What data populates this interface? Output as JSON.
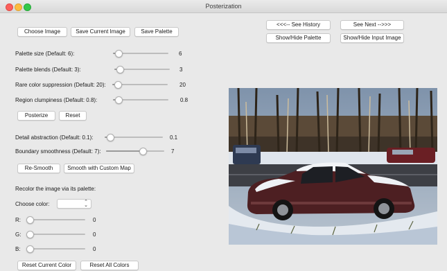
{
  "window": {
    "title": "Posterization"
  },
  "toolbar": {
    "choose_image": "Choose Image",
    "save_current_image": "Save Current Image",
    "save_palette": "Save Palette"
  },
  "nav": {
    "see_history": "<<<-- See History",
    "see_next": "See Next -->>>",
    "show_hide_palette": "Show/Hide Palette",
    "show_hide_input_image": "Show/Hide Input Image"
  },
  "posterize_controls": {
    "palette_size": {
      "label": "Palette size (Default: 6):",
      "value": "6",
      "level": 0.1
    },
    "palette_blends": {
      "label": "Palette blends (Default: 3):",
      "value": "3",
      "level": 0.1
    },
    "rare_color": {
      "label": "Rare color suppression (Default: 20):",
      "value": "20",
      "level": 0.1
    },
    "region_clumpiness": {
      "label": "Region clumpiness (Default: 0.8):",
      "value": "0.8",
      "level": 0.1
    },
    "posterize_button": "Posterize",
    "reset_button": "Reset"
  },
  "smooth_controls": {
    "detail_abstraction": {
      "label": "Detail abstraction (Default: 0.1):",
      "value": "0.1",
      "level": 0.1
    },
    "boundary_smoothness": {
      "label": "Boundary smoothness (Default: 7):",
      "value": "7",
      "level": 0.63
    },
    "resmooth_button": "Re-Smooth",
    "smooth_custom_button": "Smooth with Custom Map"
  },
  "recolor": {
    "heading": "Recolor the image via its palette:",
    "choose_color_label": "Choose color:",
    "selected_color": "",
    "r": {
      "label": "R:",
      "value": "0",
      "level": 0.0
    },
    "g": {
      "label": "G:",
      "value": "0",
      "level": 0.0
    },
    "b": {
      "label": "B:",
      "value": "0",
      "level": 0.0
    },
    "reset_current_color": "Reset Current Color",
    "reset_all_colors": "Reset All Colors"
  },
  "colors": {
    "window_bg": "#e9e9e9",
    "close": "#fc605c",
    "minimize": "#fdbc40",
    "maximize": "#34c84a"
  },
  "icons": {
    "select_arrows": "up-down-chevron-icon"
  }
}
